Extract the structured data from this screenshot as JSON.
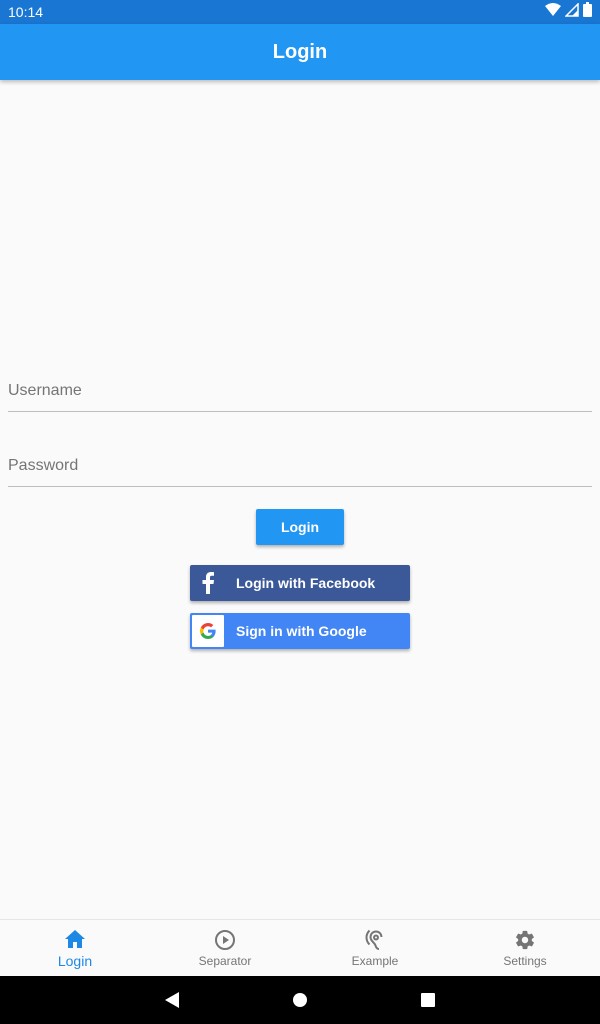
{
  "status_bar": {
    "time": "10:14",
    "icons": [
      "wifi-icon",
      "signal-icon",
      "battery-icon"
    ]
  },
  "app_bar": {
    "title": "Login",
    "color": "#2196f3"
  },
  "form": {
    "username": {
      "placeholder": "Username",
      "value": ""
    },
    "password": {
      "placeholder": "Password",
      "value": ""
    },
    "login_label": "Login"
  },
  "social": {
    "facebook": {
      "label": "Login with Facebook",
      "icon": "facebook-icon",
      "color": "#3b5998"
    },
    "google": {
      "label": "Sign in with Google",
      "icon": "google-icon",
      "color": "#4285f4"
    }
  },
  "bottom_nav": {
    "items": [
      {
        "label": "Login",
        "icon": "home-icon",
        "active": true
      },
      {
        "label": "Separator",
        "icon": "play-circle-icon",
        "active": false
      },
      {
        "label": "Example",
        "icon": "hearing-icon",
        "active": false
      },
      {
        "label": "Settings",
        "icon": "gear-icon",
        "active": false
      }
    ],
    "active_color": "#1e88e5"
  },
  "system_nav": {
    "buttons": [
      "back-icon",
      "home-circle-icon",
      "recents-icon"
    ]
  }
}
